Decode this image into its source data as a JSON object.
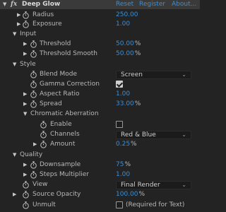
{
  "header": {
    "fx_label": "fx",
    "title": "Deep Glow",
    "reset": "Reset",
    "register": "Register",
    "about": "About..."
  },
  "radius": {
    "label": "Radius",
    "value": "250.00"
  },
  "exposure": {
    "label": "Exposure",
    "value": "1.00"
  },
  "input": {
    "label": "Input",
    "threshold": {
      "label": "Threshold",
      "value": "50.00",
      "unit": "%"
    },
    "threshold_smooth": {
      "label": "Threshold Smooth",
      "value": "50.00",
      "unit": "%"
    }
  },
  "style": {
    "label": "Style",
    "blend_mode": {
      "label": "Blend Mode",
      "value": "Screen"
    },
    "gamma_correction": {
      "label": "Gamma Correction",
      "checked": true
    },
    "aspect_ratio": {
      "label": "Aspect Ratio",
      "value": "1.00"
    },
    "spread": {
      "label": "Spread",
      "value": "33.00",
      "unit": "%"
    },
    "chromatic_aberration": {
      "label": "Chromatic Aberration",
      "enable": {
        "label": "Enable",
        "checked": false
      },
      "channels": {
        "label": "Channels",
        "value": "Red & Blue"
      },
      "amount": {
        "label": "Amount",
        "value": "0.25",
        "unit": "%"
      }
    }
  },
  "quality": {
    "label": "Quality",
    "downsample": {
      "label": "Downsample",
      "value": "75",
      "unit": "%"
    },
    "steps_multiplier": {
      "label": "Steps Multiplier",
      "value": "1.00"
    }
  },
  "view": {
    "label": "View",
    "value": "Final Render"
  },
  "source_opacity": {
    "label": "Source Opacity",
    "value": "100.00",
    "unit": "%"
  },
  "unmult": {
    "label": "Unmult",
    "checked": false,
    "note": "(Required for Text)"
  },
  "icons": {
    "expand": "triangle-right-icon",
    "collapse": "triangle-down-icon",
    "stopwatch": "stopwatch-icon",
    "dropdown": "chevron-down-icon"
  }
}
